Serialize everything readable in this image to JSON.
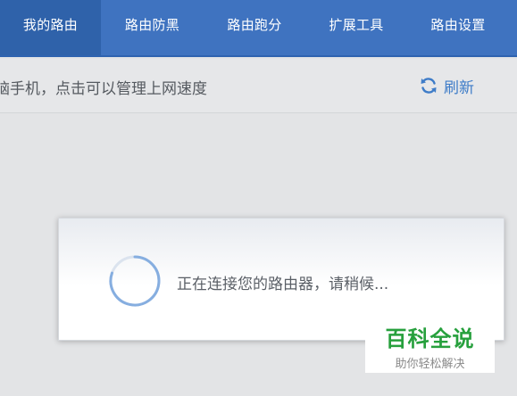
{
  "nav": {
    "tabs": [
      {
        "label": "我的路由",
        "active": true
      },
      {
        "label": "路由防黑",
        "active": false
      },
      {
        "label": "路由跑分",
        "active": false
      },
      {
        "label": "扩展工具",
        "active": false
      },
      {
        "label": "路由设置",
        "active": false
      }
    ]
  },
  "subheader": {
    "hint": "脑手机，点击可以管理上网速度",
    "refresh_label": "刷新",
    "refresh_icon": "refresh-icon"
  },
  "dialog": {
    "message": "正在连接您的路由器，请稍候...",
    "spinner_icon": "loading-spinner-icon"
  },
  "watermark": {
    "title": "百科全说",
    "subtitle": "助你轻松解决"
  },
  "colors": {
    "nav_bg": "#3f73c0",
    "nav_active_bg": "#2f62aa",
    "accent_blue": "#3e7cc8",
    "watermark_green": "#27a03d"
  }
}
